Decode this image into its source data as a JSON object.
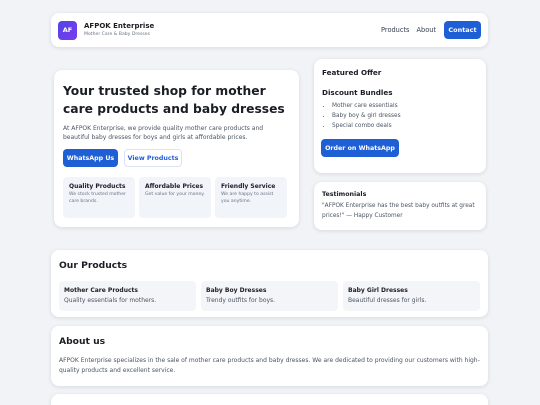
{
  "header": {
    "logo_text": "AF",
    "brand_name": "AFPOK Enterprise",
    "brand_sub": "Mother Care & Baby Dresses",
    "nav": [
      "Products",
      "About"
    ],
    "contact_label": "Contact"
  },
  "hero": {
    "title": "Your trusted shop for mother care products and baby dresses",
    "description": "At AFPOK Enterprise, we provide quality mother care products and beautiful baby dresses for boys and girls at affordable prices.",
    "whatsapp_label": "WhatsApp Us",
    "view_products_label": "View Products",
    "features": [
      {
        "title": "Quality Products",
        "desc": "We stock trusted mother care brands."
      },
      {
        "title": "Affordable Prices",
        "desc": "Get value for your money."
      },
      {
        "title": "Friendly Service",
        "desc": "We are happy to assist you anytime."
      }
    ]
  },
  "offer": {
    "heading": "Featured Offer",
    "subheading": "Discount Bundles",
    "items": [
      "Mother care essentials",
      "Baby boy & girl dresses",
      "Special combo deals"
    ],
    "button_label": "Order on WhatsApp"
  },
  "testimonials": {
    "heading": "Testimonials",
    "quote": "\"AFPOK Enterprise has the best baby outfits at great prices!\" — Happy Customer"
  },
  "products": {
    "title": "Our Products",
    "items": [
      {
        "title": "Mother Care Products",
        "desc": "Quality essentials for mothers."
      },
      {
        "title": "Baby Boy Dresses",
        "desc": "Trendy outfits for boys."
      },
      {
        "title": "Baby Girl Dresses",
        "desc": "Beautiful dresses for girls."
      }
    ]
  },
  "about": {
    "title": "About us",
    "text": "AFPOK Enterprise specializes in the sale of mother care products and baby dresses. We are dedicated to providing our customers with high-quality products and excellent service."
  },
  "colors": {
    "primary": "#1f5fd6",
    "background": "#f1f3f6",
    "logo_gradient": [
      "#4f46e5",
      "#7c3aed"
    ]
  }
}
